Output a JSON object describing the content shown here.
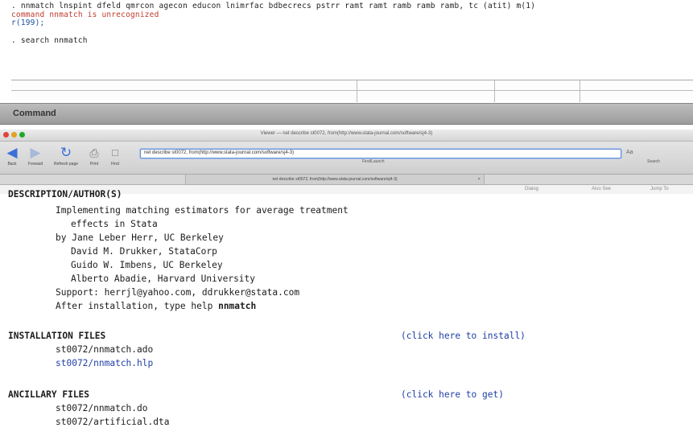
{
  "results": {
    "command_echo": ". nnmatch lnspint dfeld qmrcon agecon educon lnimrfac bdbecrecs pstrr ramt ramt ramb ramb ramb, tc (atit) m(1)",
    "error_message": "command nnmatch is unrecognized",
    "error_code": "r(199);",
    "search_echo": ". search nnmatch"
  },
  "command_panel": {
    "title": "Command"
  },
  "viewer": {
    "window_title": "Viewer — net describe st0072, from(http://www.stata-journal.com/software/sj4-3)",
    "toolbar": {
      "back": "Back",
      "forward": "Forward",
      "refresh": "Refresh page",
      "print": "Print",
      "find": "Find",
      "url_value": "net describe st0072, from(http://www.stata-journal.com/software/sj4-3)",
      "find_label": "Find/Launch",
      "search_label": "Search",
      "text_size": "Aa"
    },
    "tab": {
      "label": "net describe st0072, from(http://www.stata-journal.com/software/sj4-3)",
      "close": "×"
    },
    "subbar": {
      "item1": "Dialog",
      "item2": "Also See",
      "item3": "Jump To"
    },
    "content": {
      "heading_partial": "DESCRIPTION/AUTHOR(S)",
      "desc_line1": "Implementing matching estimators for average treatment",
      "desc_line2": "effects in Stata",
      "author1": "by Jane Leber Herr, UC Berkeley",
      "author2": "David M. Drukker, StataCorp",
      "author3": "Guido W. Imbens, UC Berkeley",
      "author4": "Alberto Abadie, Harvard University",
      "support": "Support:  herrjl@yahoo.com, ddrukker@stata.com",
      "after_install_prefix": "After installation, type help ",
      "after_install_cmd": "nnmatch",
      "install_heading": "INSTALLATION FILES",
      "install_link": "(click here to install)",
      "install_file1": "st0072/nnmatch.ado",
      "install_file2": "st0072/nnmatch.hlp",
      "ancillary_heading": "ANCILLARY FILES",
      "ancillary_link": "(click here to get)",
      "ancillary_file1": "st0072/nnmatch.do",
      "ancillary_file2": "st0072/artificial.dta"
    }
  },
  "colors": {
    "error": "#c0392b",
    "link": "#1f3fa5",
    "url_focus": "#6a8fd0"
  },
  "icons": [
    "back-arrow-icon",
    "forward-arrow-icon",
    "refresh-icon",
    "print-icon",
    "find-icon"
  ]
}
